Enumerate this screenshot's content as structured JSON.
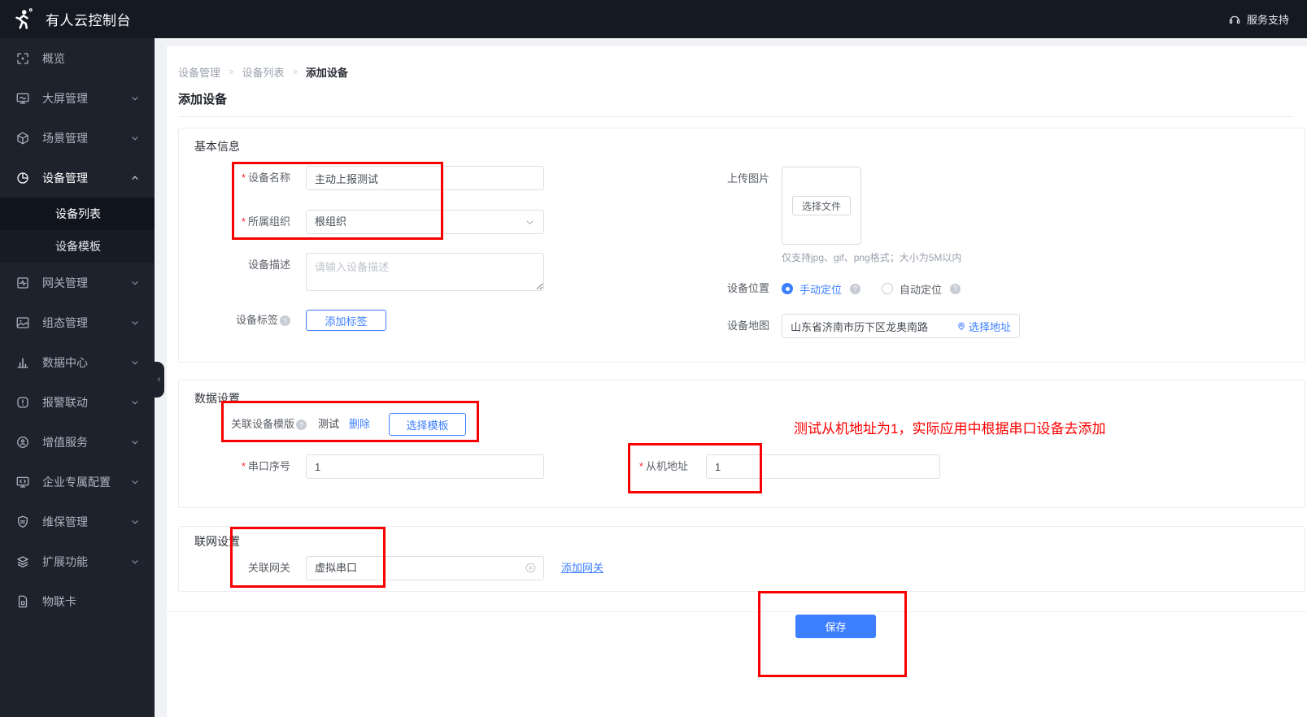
{
  "topbar": {
    "title": "有人云控制台",
    "support": "服务支持"
  },
  "icons": {
    "logo": "running-person",
    "support": "headset",
    "collapse": "‹",
    "help_mark": "?",
    "required_mark": "*"
  },
  "sidebar": {
    "overview": "概览",
    "screen": "大屏管理",
    "scene": "场景管理",
    "device": "设备管理",
    "device_list": "设备列表",
    "device_template": "设备模板",
    "gateway": "网关管理",
    "scada": "组态管理",
    "data_center": "数据中心",
    "alarm": "报警联动",
    "vas": "增值服务",
    "enterprise": "企业专属配置",
    "maintenance": "维保管理",
    "extension": "扩展功能",
    "iot_card": "物联卡"
  },
  "breadcrumb": {
    "items": [
      "设备管理",
      "设备列表",
      "添加设备"
    ],
    "separator": ">"
  },
  "page": {
    "title": "添加设备"
  },
  "basic": {
    "section_title": "基本信息",
    "device_name_label": "设备名称",
    "device_name_value": "主动上报测试",
    "org_label": "所属组织",
    "org_value": "根组织",
    "desc_label": "设备描述",
    "desc_placeholder": "请输入设备描述",
    "tag_label": "设备标签",
    "add_tag_button": "添加标签",
    "upload_label": "上传图片",
    "choose_file_button": "选择文件",
    "upload_hint": "仅支持jpg、gif、png格式；大小为5M以内",
    "location_label": "设备位置",
    "manual_location": "手动定位",
    "auto_location": "自动定位",
    "map_label": "设备地图",
    "map_value": "山东省济南市历下区龙奥南路",
    "choose_address_link": "选择地址"
  },
  "data_settings": {
    "section_title": "数据设置",
    "template_label": "关联设备模版",
    "template_value": "测试",
    "delete_link": "删除",
    "choose_template_button": "选择模板",
    "serial_label": "串口序号",
    "serial_value": "1",
    "slave_label": "从机地址",
    "slave_value": "1",
    "annotation": "测试从机地址为1，实际应用中根据串口设备去添加"
  },
  "network": {
    "section_title": "联网设置",
    "gateway_label": "关联网关",
    "gateway_value": "虚拟串口",
    "add_gateway_link": "添加网关"
  },
  "footer": {
    "save_button": "保存"
  },
  "colors": {
    "accent": "#3d7fff",
    "annotation_red": "#f70000",
    "topbar_bg": "#151922",
    "sidebar_bg": "#1e222c",
    "submenu_bg": "#171b24",
    "submenu_active_bg": "#10141c",
    "content_bg": "#f0f2f5"
  }
}
